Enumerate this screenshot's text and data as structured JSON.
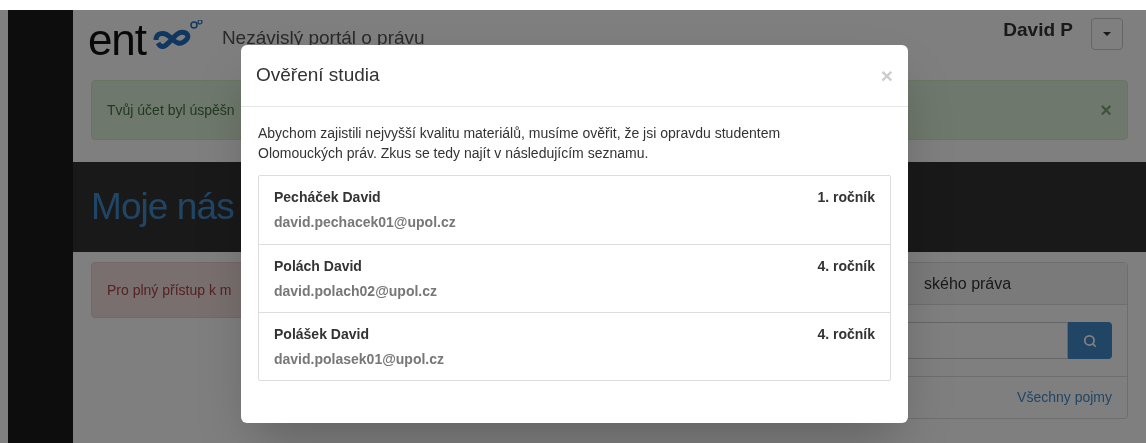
{
  "header": {
    "logo_text": "ent",
    "tagline": "Nezávislý portál o právu",
    "user": "David P"
  },
  "success_alert": {
    "text": "Tvůj účet byl úspěšn",
    "close": "×"
  },
  "page_title": "Moje nás",
  "danger_alert": {
    "text": "Pro plný přístup k m"
  },
  "side_panel": {
    "title": "ského práva",
    "link": "Všechny pojmy"
  },
  "modal": {
    "title": "Ověření studia",
    "close": "×",
    "text": "Abychom zajistili nejvyšší kvalitu materiálů, musíme ověřit, že jsi opravdu studentem Olomouckých práv. Zkus se tedy najít v následujícím seznamu.",
    "students": [
      {
        "name": "Pecháček David",
        "email": "david.pechacek01@upol.cz",
        "year": "1. ročník"
      },
      {
        "name": "Polách David",
        "email": "david.polach02@upol.cz",
        "year": "4. ročník"
      },
      {
        "name": "Polášek David",
        "email": "david.polasek01@upol.cz",
        "year": "4. ročník"
      }
    ]
  }
}
